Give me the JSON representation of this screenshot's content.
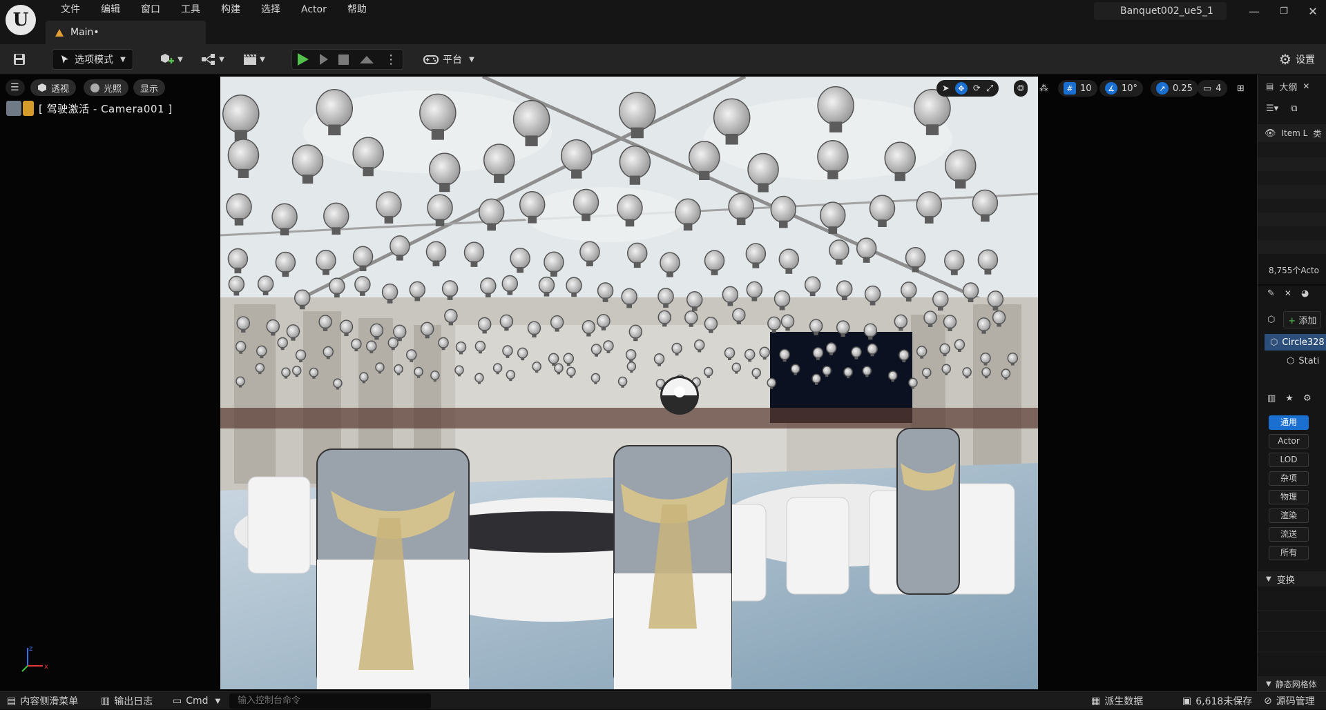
{
  "menu": {
    "items": [
      "文件",
      "编辑",
      "窗口",
      "工具",
      "构建",
      "选择",
      "Actor",
      "帮助"
    ]
  },
  "tab": {
    "label": "Main•"
  },
  "project": {
    "name": "Banquet002_ue5_1"
  },
  "toolbar": {
    "mode_label": "选项模式",
    "platform_label": "平台",
    "settings_label": "设置"
  },
  "viewport": {
    "perspective_label": "透视",
    "lighting_label": "光照",
    "show_label": "显示",
    "camera_label": "[ 驾驶激活 - Camera001 ]",
    "grid_snap": "10",
    "rotate_snap": "10°",
    "scale_snap": "0.25",
    "camera_speed": "4"
  },
  "outliner": {
    "title": "大纲",
    "column_item": "Item L",
    "column_type": "类",
    "actor_count": "8,755个Acto"
  },
  "details": {
    "add_label": "添加",
    "selected_actor": "Circle328",
    "component": "Stati",
    "categories": [
      "通用",
      "Actor",
      "LOD",
      "杂项",
      "物理",
      "渲染",
      "流送",
      "所有"
    ],
    "active_category": "通用",
    "transform_section": "变换",
    "static_mesh_section": "静态网格体"
  },
  "statusbar": {
    "content_drawer": "内容侧滑菜单",
    "output_log": "输出日志",
    "cmd_label": "Cmd",
    "cmd_placeholder": "输入控制台命令",
    "derived_data": "派生数据",
    "unsaved": "6,618未保存",
    "source_control": "源码管理"
  },
  "colors": {
    "accent_blue": "#1a6fd0",
    "play_green": "#54c04d",
    "tab_orange": "#e2a036"
  }
}
